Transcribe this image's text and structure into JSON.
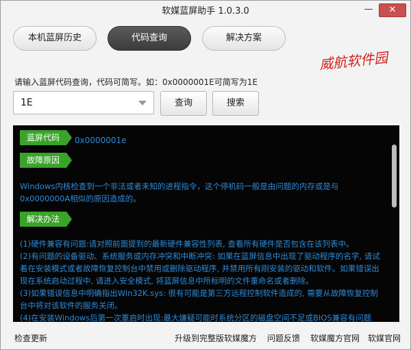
{
  "window": {
    "title": "软媒蓝屏助手 1.0.3.0",
    "minimize": "—",
    "close": "✕"
  },
  "tabs": [
    {
      "label": "本机蓝屏历史"
    },
    {
      "label": "代码查询"
    },
    {
      "label": "解决方案"
    }
  ],
  "watermark": "威航软件园",
  "query": {
    "hint": "请输入蓝屏代码查询，代码可简写。如：0x0000001E可简写为1E",
    "input_value": "1E",
    "query_button": "查询",
    "search_button": "搜索"
  },
  "result": {
    "code_label": "蓝屏代码",
    "code_value": "0x0000001e",
    "cause_label": "故障原因",
    "cause_text": "Windows内核检查到一个非法或者未知的进程指令，这个停机码一般是由问题的内存或是与0x0000000A相似的原因造成的。",
    "solution_label": "解决办法",
    "solution_text": [
      "(1)硬件兼容有问题:请对照前面提到的最新硬件兼容性列表, 查看所有硬件是否包含在该列表中。",
      "(2)有问题的设备驱动、系统服务或内存冲突和中断冲突: 如果在蓝屏信息中出现了驱动程序的名字, 请试着在安装模式或者故障恢复控制台中禁用或删除驱动程序, 并禁用所有刚安装的驱动和软件。如果错误出现在系统启动过程中, 请进入安全模式, 将蓝屏信息中所标明的文件重命名或者删除。",
      "(3)如果错误信息中明确指出Win32K.sys: 很有可能是第三方远程控制软件造成的, 需要从故障恢复控制台中将对该软件的服务关闭。",
      "(4)在安装Windows后第一次重启时出现:最大嫌疑可能时系统分区的磁盘空间不足或BIOS兼容有问题"
    ]
  },
  "footer": {
    "check_update": "检查更新",
    "upgrade": "升级到完整版软媒魔方",
    "feedback": "问题反馈",
    "mofang_site": "软媒魔方官网",
    "ruanmei_site": "软媒官网"
  }
}
